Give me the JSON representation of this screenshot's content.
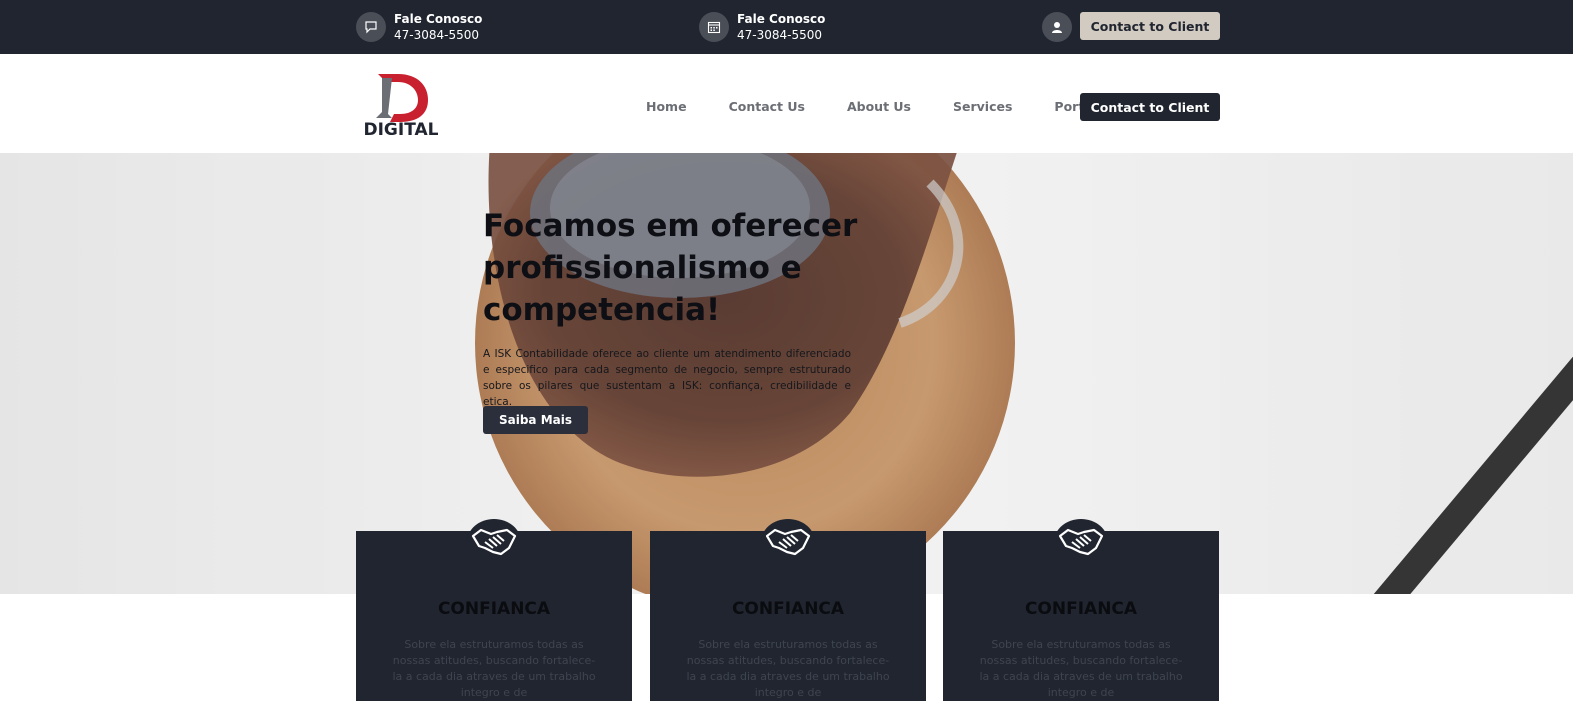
{
  "topbar": {
    "contacts": [
      {
        "title": "Fale Conosco",
        "phone": "47-3084-5500",
        "icon": "chat-icon"
      },
      {
        "title": "Fale Conosco",
        "phone": "47-3084-5500",
        "icon": "calendar-icon"
      }
    ],
    "user_icon": "user-icon",
    "button_label": "Contact to Client"
  },
  "header": {
    "logo_text": "DIGITAL",
    "nav": [
      "Home",
      "Contact Us",
      "About Us",
      "Services",
      "Portfolio"
    ],
    "button_label": "Contact to Client"
  },
  "hero": {
    "title": "Focamos em oferecer profissionalismo e competencia!",
    "description": "A ISK Contabilidade oferece ao cliente um atendimento diferenciado e especifico para cada segmento de negocio, sempre estruturado sobre os pilares que sustentam a ISK: confiança, credibilidade e etica.",
    "button_label": "Saiba Mais"
  },
  "cards": [
    {
      "icon": "handshake-icon",
      "title": "CONFIANCA",
      "text": "Sobre ela estruturamos todas as nossas atitudes, buscando fortalece-la a cada dia atraves de um trabalho integro e de"
    },
    {
      "icon": "handshake-icon",
      "title": "CONFIANCA",
      "text": "Sobre ela estruturamos todas as nossas atitudes, buscando fortalece-la a cada dia atraves de um trabalho integro e de"
    },
    {
      "icon": "handshake-icon",
      "title": "CONFIANCA",
      "text": "Sobre ela estruturamos todas as nossas atitudes, buscando fortalece-la a cada dia atraves de um trabalho integro e de"
    }
  ],
  "colors": {
    "dark": "#202530",
    "button_light": "#d2cbc2",
    "logo_red": "#c8202e"
  }
}
